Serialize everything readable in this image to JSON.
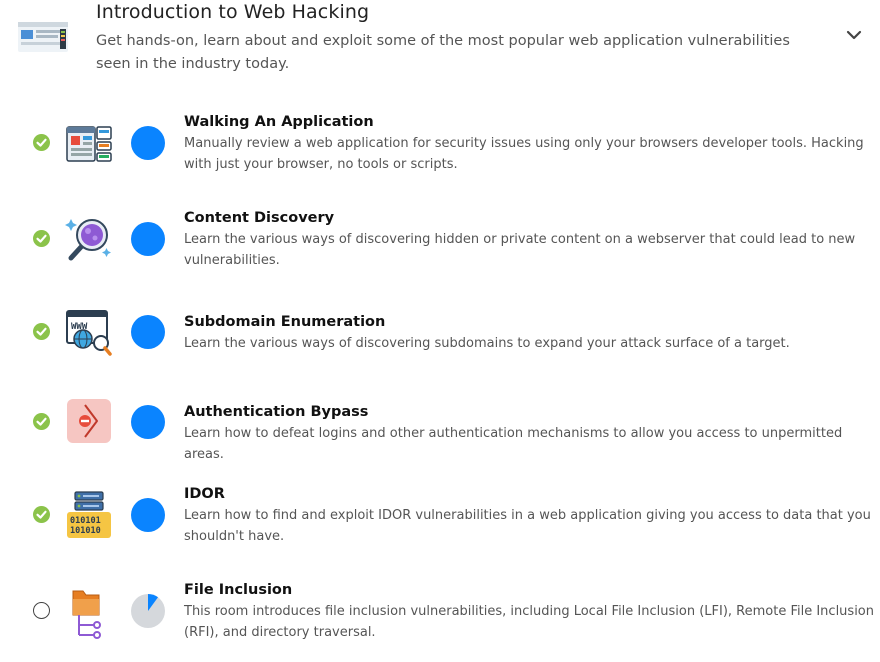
{
  "module": {
    "title": "Introduction to Web Hacking",
    "description": "Get hands-on, learn about and exploit some of the most popular web application vulnerabilities seen in the industry today.",
    "thumbnail_icon": "web-hacking-thumbnail-icon",
    "expand_icon": "chevron-down-icon"
  },
  "rooms": [
    {
      "title": "Walking An Application",
      "description": "Manually review a web application for security issues using only your browsers developer tools. Hacking with just your browser, no tools or scripts.",
      "completed": true,
      "progress": 1.0,
      "icon": "web-page-layout-icon"
    },
    {
      "title": "Content Discovery",
      "description": "Learn the various ways of discovering hidden or private content on a webserver that could lead to new vulnerabilities.",
      "completed": true,
      "progress": 1.0,
      "icon": "magnifying-glass-icon"
    },
    {
      "title": "Subdomain Enumeration",
      "description": "Learn the various ways of discovering subdomains to expand your attack surface of a target.",
      "completed": true,
      "progress": 1.0,
      "icon": "www-globe-search-icon"
    },
    {
      "title": "Authentication Bypass",
      "description": "Learn how to defeat logins and other authentication mechanisms to allow you access to unpermitted areas.",
      "completed": true,
      "progress": 1.0,
      "icon": "no-entry-arrow-icon"
    },
    {
      "title": "IDOR",
      "description": "Learn how to find and exploit IDOR vulnerabilities in a web application giving you access to data that you shouldn't have.",
      "completed": true,
      "progress": 1.0,
      "icon": "server-binary-icon"
    },
    {
      "title": "File Inclusion",
      "description": "This room introduces file inclusion vulnerabilities, including Local File Inclusion (LFI), Remote File Inclusion (RFI), and directory traversal.",
      "completed": false,
      "progress": 0.1,
      "icon": "folder-tree-icon"
    }
  ],
  "colors": {
    "progress_fill": "#0a84ff",
    "progress_track": "#d5d8dc",
    "check_done": "#8bc34a"
  }
}
